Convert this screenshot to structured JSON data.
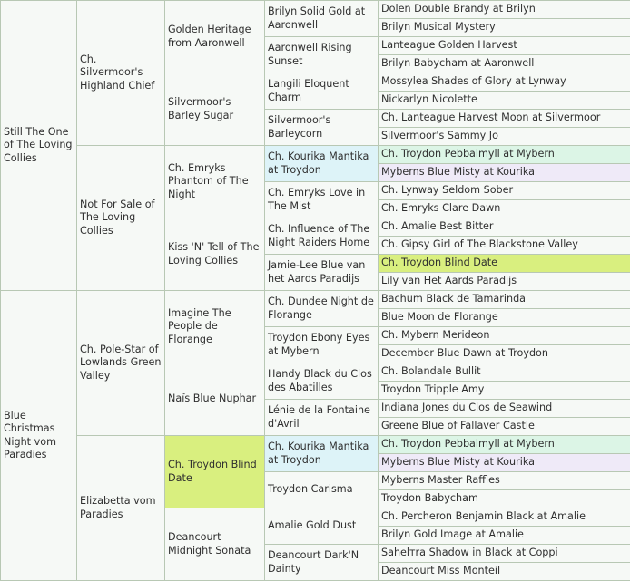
{
  "pedigree": {
    "sire": {
      "name": "Still The One of The Loving Collies",
      "sire": {
        "name": "Ch. Silvermoor's Highland Chief",
        "sire": {
          "name": "Golden Heritage from Aaronwell",
          "sire": {
            "name": "Brilyn Solid Gold at Aaronwell",
            "sire": "Dolen Double Brandy at Brilyn",
            "dam": "Brilyn Musical Mystery"
          },
          "dam": {
            "name": "Aaronwell Rising Sunset",
            "sire": "Lanteague Golden Harvest",
            "dam": "Brilyn Babycham at Aaronwell"
          }
        },
        "dam": {
          "name": "Silvermoor's Barley Sugar",
          "sire": {
            "name": "Langili Eloquent Charm",
            "sire": "Mossylea Shades of Glory at Lynway",
            "dam": "Nickarlyn Nicolette"
          },
          "dam": {
            "name": "Silvermoor's Barleycorn",
            "sire": "Ch. Lanteague Harvest Moon at Silvermoor",
            "dam": "Silvermoor's Sammy Jo"
          }
        }
      },
      "dam": {
        "name": "Not For Sale of The Loving Collies",
        "sire": {
          "name": "Ch. Emryks Phantom of The Night",
          "sire": {
            "name": "Ch. Kourika Mantika at Troydon",
            "sire": "Ch. Troydon Pebbalmyll at Mybern",
            "dam": "Myberns Blue Misty at Kourika"
          },
          "dam": {
            "name": "Ch. Emryks Love in The Mist",
            "sire": "Ch. Lynway Seldom Sober",
            "dam": "Ch. Emryks Clare Dawn"
          }
        },
        "dam": {
          "name": "Kiss 'N' Tell of The Loving Collies",
          "sire": {
            "name": "Ch. Influence of The Night Raiders Home",
            "sire": "Ch. Amalie Best Bitter",
            "dam": "Ch. Gipsy Girl of The Blackstone Valley"
          },
          "dam": {
            "name": "Jamie-Lee Blue van het Aards Paradijs",
            "sire": "Ch. Troydon Blind Date",
            "dam": "Lily van Het Aards Paradijs"
          }
        }
      }
    },
    "dam": {
      "name": "Blue Christmas Night vom Paradies",
      "sire": {
        "name": "Ch. Pole-Star of Lowlands Green Valley",
        "sire": {
          "name": "Imagine The People de Florange",
          "sire": {
            "name": "Ch. Dundee Night de Florange",
            "sire": "Bachum Black de Tamarinda",
            "dam": "Blue Moon de Florange"
          },
          "dam": {
            "name": "Troydon Ebony Eyes at Mybern",
            "sire": "Ch. Mybern Merideon",
            "dam": "December Blue Dawn at Troydon"
          }
        },
        "dam": {
          "name": "Naïs Blue Nuphar",
          "sire": {
            "name": "Handy Black du Clos des Abatilles",
            "sire": "Ch. Bolandale Bullit",
            "dam": "Troydon Tripple Amy"
          },
          "dam": {
            "name": "Lénie de la Fontaine d'Avril",
            "sire": "Indiana Jones du Clos de Seawind",
            "dam": "Greene Blue of Fallaver Castle"
          }
        }
      },
      "dam": {
        "name": "Elizabetta vom Paradies",
        "sire": {
          "name": "Ch. Troydon Blind Date",
          "sire": {
            "name": "Ch. Kourika Mantika at Troydon",
            "sire": "Ch. Troydon Pebbalmyll at Mybern",
            "dam": "Myberns Blue Misty at Kourika"
          },
          "dam": {
            "name": "Troydon Carisma",
            "sire": "Myberns Master Raffles",
            "dam": "Troydon Babycham"
          }
        },
        "dam": {
          "name": "Deancourt Midnight Sonata",
          "sire": {
            "name": "Amalie Gold Dust",
            "sire": "Ch. Percheron Benjamin Black at Amalie",
            "dam": "Brilyn Gold Image at Amalie"
          },
          "dam": {
            "name": "Deancourt Dark'N Dainty",
            "sire": "Sahelтra Shadow in Black at Coppi",
            "dam": "Deancourt Miss Monteil"
          }
        }
      }
    }
  },
  "colors": {
    "cell_background": "#f6f9f6",
    "border": "#b8c8b4",
    "highlight_green": "#dcf5e6",
    "highlight_purple": "#efeaf8",
    "highlight_yellow": "#d9ef7f",
    "highlight_cyan": "#ddf3f8"
  }
}
